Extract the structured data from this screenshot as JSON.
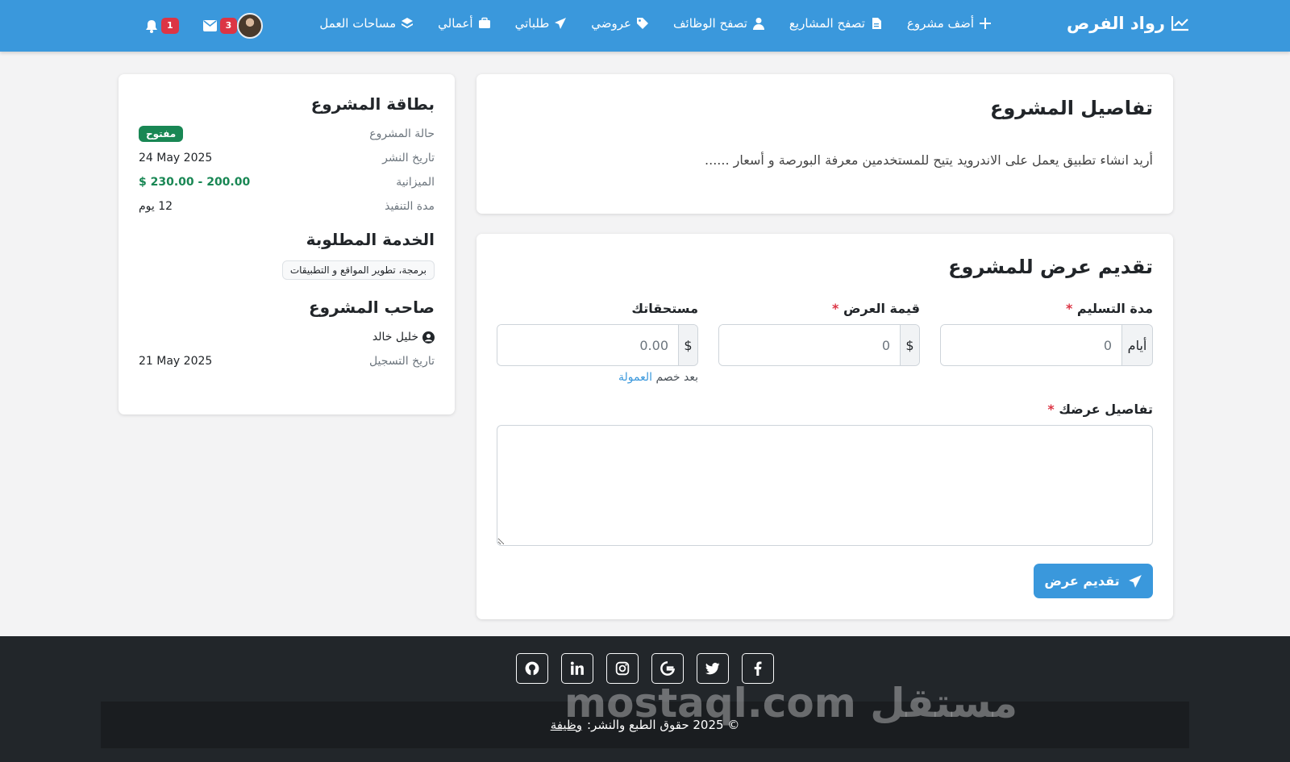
{
  "nav": {
    "brand": "رواد الفرص",
    "links": [
      {
        "label": "أضف مشروع",
        "icon": "plus-icon"
      },
      {
        "label": "تصفح المشاريع",
        "icon": "file-icon"
      },
      {
        "label": "تصفح الوظائف",
        "icon": "user-tie-icon"
      },
      {
        "label": "عروضي",
        "icon": "tags-icon"
      },
      {
        "label": "طلباتي",
        "icon": "paper-plane-icon"
      },
      {
        "label": "أعمالي",
        "icon": "briefcase-icon"
      },
      {
        "label": "مساحات العمل",
        "icon": "layers-icon"
      }
    ],
    "notifications_count": "1",
    "messages_count": "3",
    "colors": {
      "primary": "#3a98dc",
      "badge": "#dc3545"
    }
  },
  "project": {
    "title": "تفاصيل المشروع",
    "description": "أريد انشاء تطبيق يعمل على الاندرويد يتيح للمستخدمين معرفة البورصة و أسعار ......"
  },
  "offer_form": {
    "title": "تقديم عرض للمشروع",
    "delivery_label": "مدة التسليم",
    "delivery_addon": "أيام",
    "delivery_placeholder": "0",
    "price_label": "قيمة العرض",
    "price_addon": "$",
    "price_placeholder": "0",
    "earnings_label": "مستحقاتك",
    "earnings_addon": "$",
    "earnings_placeholder": "0.00",
    "earnings_hint_prefix": "بعد خصم",
    "earnings_hint_link": "العمولة",
    "details_label": "تفاصيل عرضك",
    "required_mark": "*",
    "submit_label": "تقديم عرض"
  },
  "project_card": {
    "title": "بطاقة المشروع",
    "status_label": "حالة المشروع",
    "status_value": "مفتوح",
    "published_label": "تاريخ النشر",
    "published_value": "24 May 2025",
    "budget_label": "الميزانية",
    "budget_value": "$ 230.00 - 200.00",
    "duration_label": "مدة التنفيذ",
    "duration_value": "12 يوم",
    "service_title": "الخدمة المطلوبة",
    "service_tag": "برمجة، تطوير المواقع و التطبيقات",
    "owner_title": "صاحب المشروع",
    "owner_name": "خليل خالد",
    "registered_label": "تاريخ التسجيل",
    "registered_value": "21 May 2025"
  },
  "footer": {
    "social": [
      "github-icon",
      "linkedin-icon",
      "instagram-icon",
      "google-icon",
      "twitter-icon",
      "facebook-icon"
    ],
    "copyright": "© 2025 حقوق الطبع والنشر:",
    "copyright_link": "وظيفة",
    "watermark": "مستقل mostaql.com"
  }
}
